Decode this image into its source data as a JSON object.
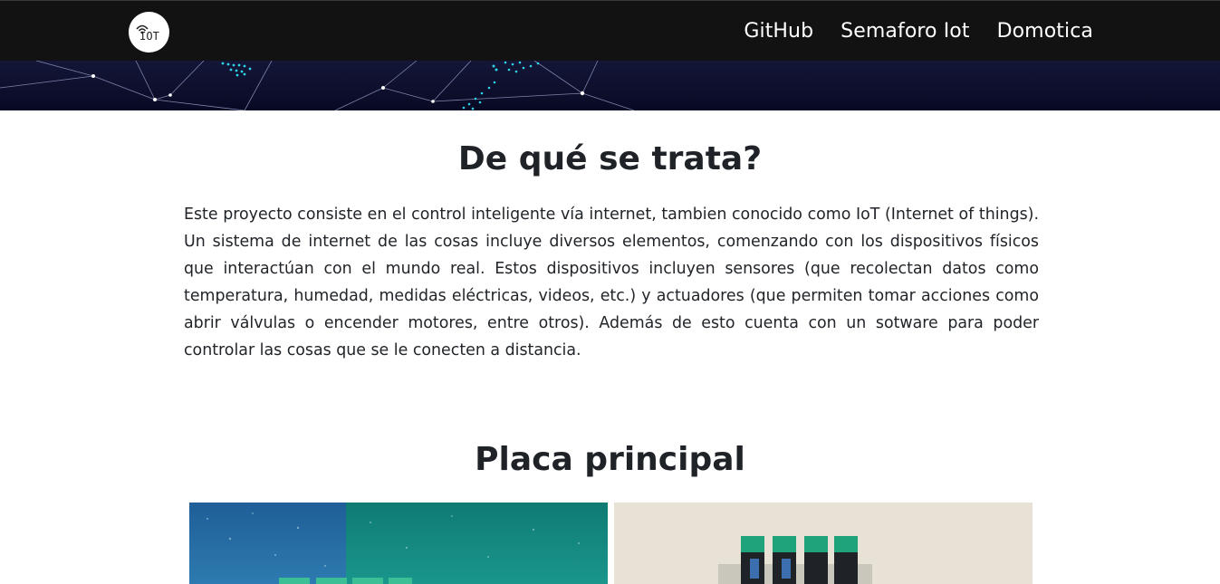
{
  "navbar": {
    "logo_text": "IOT",
    "links": [
      {
        "label": "GitHub"
      },
      {
        "label": "Semaforo Iot"
      },
      {
        "label": "Domotica"
      }
    ]
  },
  "sections": {
    "about": {
      "title": "De qué se trata?",
      "body": "Este proyecto consiste en el control inteligente vía internet, tambien conocido como IoT (Internet of things). Un sistema de internet de las cosas incluye diversos elementos, comenzando con los dispositivos físicos que interactúan con el mundo real. Estos dispositivos incluyen sensores (que recolectan datos como temperatura, humedad, medidas eléctricas, videos, etc.) y actuadores (que permiten tomar acciones como abrir válvulas o encender motores, entre otros). Además de esto cuenta con un sotware para poder controlar las cosas que se le conecten a distancia."
    },
    "board": {
      "title": "Placa principal"
    }
  },
  "colors": {
    "navbar_bg": "#121212",
    "hero_bg": "#0d0f2e",
    "text": "#212529"
  }
}
